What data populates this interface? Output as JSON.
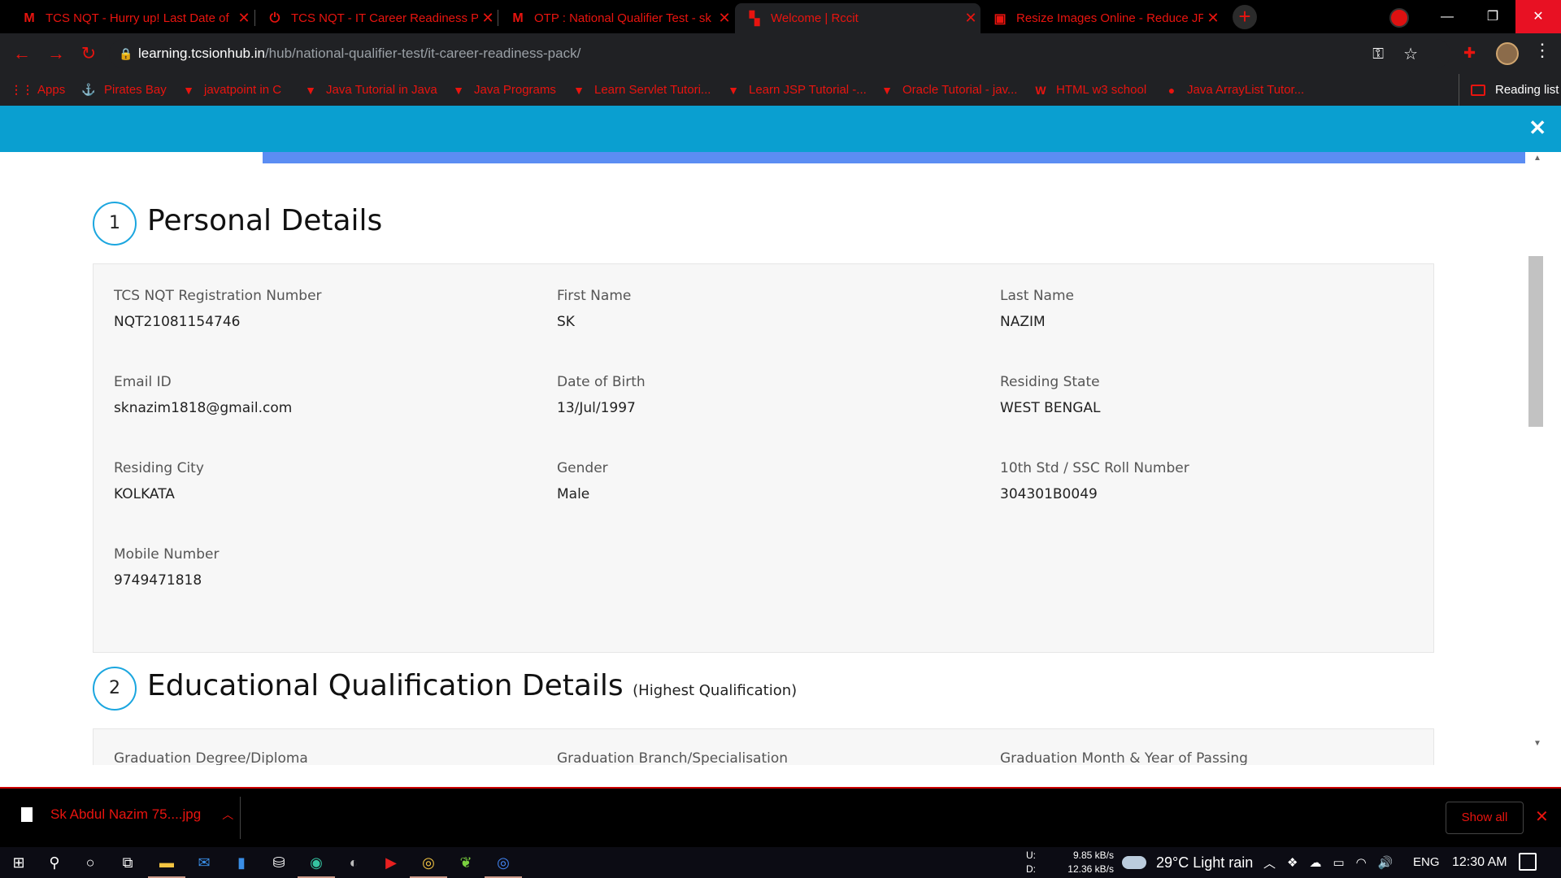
{
  "browser": {
    "tabs": [
      {
        "title": "TCS NQT - Hurry up! Last Date of",
        "icon": "gmail-icon",
        "glyph": "M",
        "active": false
      },
      {
        "title": "TCS NQT - IT Career Readiness P",
        "icon": "power-icon",
        "glyph": "⏻",
        "active": false
      },
      {
        "title": "OTP : National Qualifier Test - sk",
        "icon": "gmail-icon",
        "glyph": "M",
        "active": false
      },
      {
        "title": "Welcome | Rccit",
        "icon": "rccit-icon",
        "glyph": "▚",
        "active": true
      },
      {
        "title": "Resize Images Online - Reduce JP",
        "icon": "resize-icon",
        "glyph": "▣",
        "active": false
      }
    ],
    "url_host": "learning.tcsionhub.in",
    "url_path": "/hub/national-qualifier-test/it-career-readiness-pack/",
    "bookmarks": [
      {
        "label": "Apps",
        "icon": "apps-grid-icon",
        "glyph": "⋮⋮"
      },
      {
        "label": "Pirates Bay",
        "icon": "pirate-ship-icon",
        "glyph": "⚓"
      },
      {
        "label": "javatpoint in C",
        "icon": "javatpoint-icon",
        "glyph": "▼"
      },
      {
        "label": "Java Tutorial in Java",
        "icon": "javatpoint-icon",
        "glyph": "▼"
      },
      {
        "label": "Java Programs",
        "icon": "javatpoint-icon",
        "glyph": "▼"
      },
      {
        "label": "Learn Servlet Tutori...",
        "icon": "javatpoint-icon",
        "glyph": "▼"
      },
      {
        "label": "Learn JSP Tutorial -...",
        "icon": "javatpoint-icon",
        "glyph": "▼"
      },
      {
        "label": "Oracle Tutorial - jav...",
        "icon": "javatpoint-icon",
        "glyph": "▼"
      },
      {
        "label": "HTML w3 school",
        "icon": "w3schools-icon",
        "glyph": "W"
      },
      {
        "label": "Java ArrayList Tutor...",
        "icon": "green-circle-icon",
        "glyph": "●"
      }
    ],
    "reading_list": "Reading list"
  },
  "sections": {
    "personal": {
      "number": "1",
      "title": "Personal Details",
      "fields": [
        {
          "label": "TCS NQT Registration Number",
          "value": "NQT21081154746"
        },
        {
          "label": "First Name",
          "value": "SK"
        },
        {
          "label": "Last Name",
          "value": "NAZIM"
        },
        {
          "label": "Email ID",
          "value": "sknazim1818@gmail.com"
        },
        {
          "label": "Date of Birth",
          "value": "13/Jul/1997"
        },
        {
          "label": "Residing State",
          "value": "WEST BENGAL"
        },
        {
          "label": "Residing City",
          "value": "KOLKATA"
        },
        {
          "label": "Gender",
          "value": "Male"
        },
        {
          "label": "10th Std / SSC Roll Number",
          "value": "304301B0049"
        },
        {
          "label": "Mobile Number",
          "value": "9749471818"
        }
      ]
    },
    "education": {
      "number": "2",
      "title": "Educational Qualification Details",
      "subtitle": "(Highest Qualification)",
      "fields": [
        {
          "label": "Graduation Degree/Diploma"
        },
        {
          "label": "Graduation Branch/Specialisation"
        },
        {
          "label": "Graduation Month & Year of Passing"
        }
      ]
    }
  },
  "downloads": {
    "file": "Sk Abdul Nazim 75....jpg",
    "show_all": "Show all"
  },
  "taskbar": {
    "upload_label": "U:",
    "download_label": "D:",
    "upload_speed": "9.85 kB/s",
    "download_speed": "12.36 kB/s",
    "weather": "29°C  Light rain",
    "language": "ENG",
    "time": "12:30 AM"
  },
  "colors": {
    "accent_red": "#e8140f",
    "modal_header": "#0a9fd0",
    "progress": "#5b8df3",
    "section_circle": "#1ba6df"
  }
}
